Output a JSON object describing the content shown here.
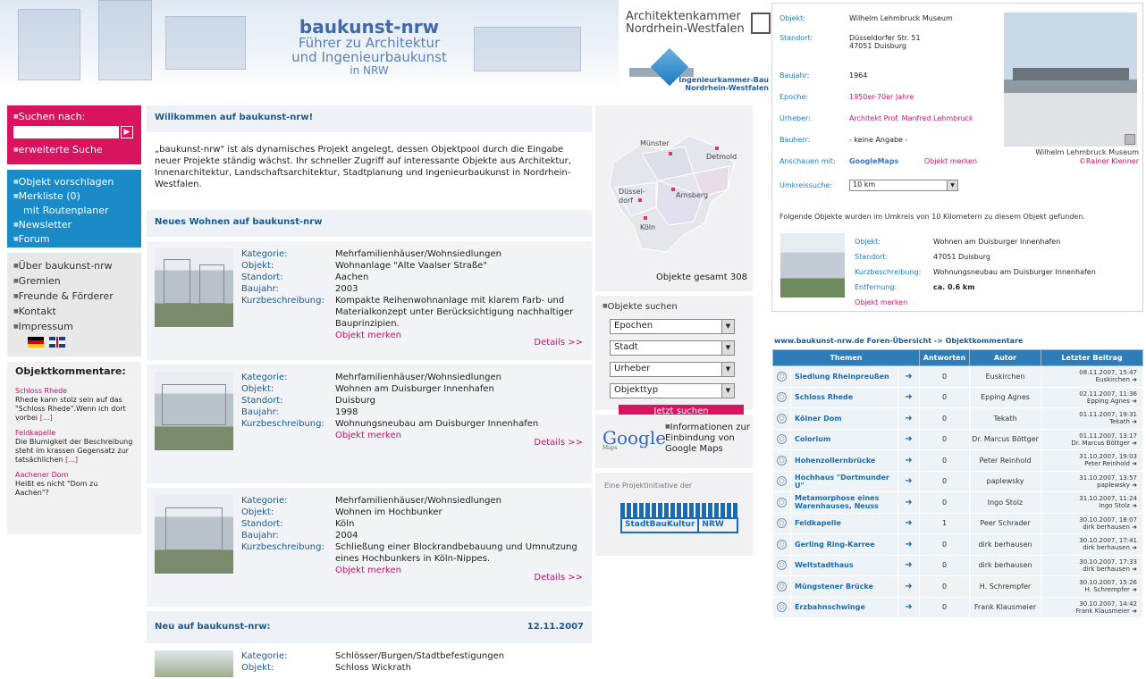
{
  "header": {
    "brand_title": "baukunst-nrw",
    "brand_line1": "Führer zu Architektur",
    "brand_line2": "und Ingenieurbaukunst",
    "brand_line3": "in NRW",
    "ak_line1": "Architektenkammer",
    "ak_line2": "Nordrhein-Westfalen",
    "ik_line1": "Ingenieurkammer-Bau",
    "ik_line2": "Nordrhein-Westfalen"
  },
  "left": {
    "search_label": "Suchen nach:",
    "search_value": "",
    "search_go": "▶",
    "advanced_search": "erweiterte Suche",
    "blue_links": [
      "Objekt vorschlagen",
      "Merkliste  (0)",
      "mit Routenplaner",
      "Newsletter",
      "Forum"
    ],
    "grey_links": [
      "Über baukunst-nrw",
      "Gremien",
      "Freunde & Förderer",
      "Kontakt",
      "Impressum"
    ],
    "comments_title": "Objektkommentare:",
    "comments": [
      {
        "title": "Schloss Rhede",
        "text": "Rhede kann stolz sein auf das \"Schloss Rhede\".Wenn ich dort vorbei ",
        "more": "[...]"
      },
      {
        "title": "Feldkapelle",
        "text": "Die Blumigkeit der Beschreibung steht im krassen Gegensatz zur tatsächlichen ",
        "more": "[...]"
      },
      {
        "title": "Aachener Dom",
        "text": "Heißt es nicht \"Dom zu Aachen\"?",
        "more": ""
      }
    ]
  },
  "main": {
    "welcome_title": "Willkommen auf baukunst-nrw!",
    "intro": "„baukunst-nrw\" ist als dynamisches Projekt angelegt, dessen Objektpool durch die Eingabe neuer Projekte ständig wächst. Ihr schneller Zugriff auf interessante Objekte aus Architektur, Innenarchitektur, Landschaftsarchitektur, Stadtplanung und Ingenieurbaukunst in Nordrhein-Westfalen.",
    "new_living_title": "Neues Wohnen auf baukunst-nrw",
    "labels": {
      "kategorie": "Kategorie:",
      "objekt": "Objekt:",
      "standort": "Standort:",
      "baujahr": "Baujahr:",
      "kurz": "Kurzbeschreibung:"
    },
    "merken": "Objekt merken",
    "details": "Details >>",
    "objects": [
      {
        "kategorie": "Mehrfamilienhäuser/Wohnsiedlungen",
        "objekt": "Wohnanlage \"Alte Vaalser Straße\"",
        "standort": "Aachen",
        "baujahr": "2003",
        "kurz": "Kompakte Reihenwohnanlage mit klarem Farb- und Materialkonzept unter Berücksichtigung nachhaltiger Bauprinzipien."
      },
      {
        "kategorie": "Mehrfamilienhäuser/Wohnsiedlungen",
        "objekt": "Wohnen am Duisburger Innenhafen",
        "standort": "Duisburg",
        "baujahr": "1998",
        "kurz": "Wohnungsneubau am Duisburger Innenhafen"
      },
      {
        "kategorie": "Mehrfamilienhäuser/Wohnsiedlungen",
        "objekt": "Wohnen im Hochbunker",
        "standort": "Köln",
        "baujahr": "2004",
        "kurz": "Schließung einer Blockrandbebauung und Umnutzung eines Hochbunkers in Köln-Nippes."
      }
    ],
    "new_title": "Neu auf baukunst-nrw:",
    "new_date": "12.11.2007",
    "new_object": {
      "kategorie": "Schlösser/Burgen/Stadtbefestigungen",
      "objekt": "Schloss Wickrath"
    }
  },
  "mid": {
    "map_cities": [
      "Münster",
      "Detmold",
      "Düssel-",
      "dorf",
      "Arnsberg",
      "Köln"
    ],
    "total": "Objekte gesamt 308",
    "find_label": "Objekte suchen",
    "selects": [
      "Epochen",
      "Stadt",
      "Urheber",
      "Objekttyp"
    ],
    "find_button": "Jetzt suchen",
    "gm_logo_g": "Google",
    "gm_logo_sub": "Maps",
    "gm_text": "Informationen zur Einbindung von Google Maps",
    "sbk_text": "Eine Projektinitiative der",
    "sbk_logo1": "StadtBauKultur",
    "sbk_logo2": "NRW"
  },
  "detail": {
    "rows": [
      {
        "k": "Objekt:",
        "v": "Wilhelm Lehmbruck Museum"
      },
      {
        "k": "Standort:",
        "v": "Düsseldorfer Str. 51",
        "v2": "47051 Duisburg"
      },
      {
        "k": "Baujahr:",
        "v": "1964"
      },
      {
        "k": "Epoche:",
        "v": "1950er-70er Jahre"
      },
      {
        "k": "Urheber:",
        "v": "Architekt Prof. Manfred Lehmbruck"
      },
      {
        "k": "Bauherr:",
        "v": "- keine Angabe -"
      }
    ],
    "show_with": "Anschauen mit:",
    "gm_label": "GoogleMaps",
    "merken": "Objekt merken",
    "caption": "Wilhelm Lehmbruck Museum",
    "credit": "©Rainer Klenner",
    "radius_label": "Umkreissuche:",
    "radius_value": "10 km",
    "found_text": "Folgende Objekte wurden im Umkreis von 10 Kilometern zu diesem Objekt gefunden.",
    "near": {
      "objekt_k": "Objekt:",
      "objekt": "Wohnen am Duisburger Innenhafen",
      "standort_k": "Standort:",
      "standort": "47051 Duisburg",
      "kurz_k": "Kurzbeschreibung:",
      "kurz": "Wohnungsneubau am Duisburger Innenhafen",
      "dist_k": "Entfernung:",
      "dist": "ca. 0.6 km",
      "merken": "Objekt merken"
    }
  },
  "forum": {
    "crumb": "www.baukunst-nrw.de Foren-Übersicht -> Objektkommentare",
    "headers": [
      "Themen",
      "Antworten",
      "Autor",
      "Letzter Beitrag"
    ],
    "rows": [
      {
        "topic": "Siedlung Rheinpreußen",
        "answers": "0",
        "author": "Euskirchen",
        "last": "08.11.2007, 15:47",
        "last_by": "Euskirchen"
      },
      {
        "topic": "Schloss Rhede",
        "answers": "0",
        "author": "Epping Agnes",
        "last": "02.11.2007, 11:36",
        "last_by": "Epping Agnes"
      },
      {
        "topic": "Kölner Dom",
        "answers": "0",
        "author": "Tekath",
        "last": "01.11.2007, 19:31",
        "last_by": "Tekath"
      },
      {
        "topic": "Colorium",
        "answers": "0",
        "author": "Dr. Marcus Böttger",
        "last": "01.11.2007, 13:17",
        "last_by": "Dr. Marcus Böttger"
      },
      {
        "topic": "Hohenzollernbrücke",
        "answers": "0",
        "author": "Peter Reinhold",
        "last": "31.10.2007, 19:03",
        "last_by": "Peter Reinhold"
      },
      {
        "topic": "Hochhaus \"Dortmunder U\"",
        "answers": "0",
        "author": "paplewsky",
        "last": "31.10.2007, 13:57",
        "last_by": "paplewsky"
      },
      {
        "topic": "Metamorphose eines Warenhauses, Neuss",
        "answers": "0",
        "author": "Ingo Stolz",
        "last": "31.10.2007, 11:24",
        "last_by": "Ingo Stolz"
      },
      {
        "topic": "Feldkapelle",
        "answers": "1",
        "author": "Peer Schrader",
        "last": "30.10.2007, 18:07",
        "last_by": "dirk berhausen"
      },
      {
        "topic": "Gerling Ring-Karree",
        "answers": "0",
        "author": "dirk berhausen",
        "last": "30.10.2007, 17:41",
        "last_by": "dirk berhausen"
      },
      {
        "topic": "Weltstadthaus",
        "answers": "0",
        "author": "dirk berhausen",
        "last": "30.10.2007, 17:33",
        "last_by": "dirk berhausen"
      },
      {
        "topic": "Müngstener Brücke",
        "answers": "0",
        "author": "H. Schrempfer",
        "last": "30.10.2007, 15:26",
        "last_by": "H. Schrempfer"
      },
      {
        "topic": "Erzbahnschwinge",
        "answers": "0",
        "author": "Frank Klausmeier",
        "last": "30.10.2007, 14:42",
        "last_by": "Frank Klausmeier"
      }
    ]
  }
}
